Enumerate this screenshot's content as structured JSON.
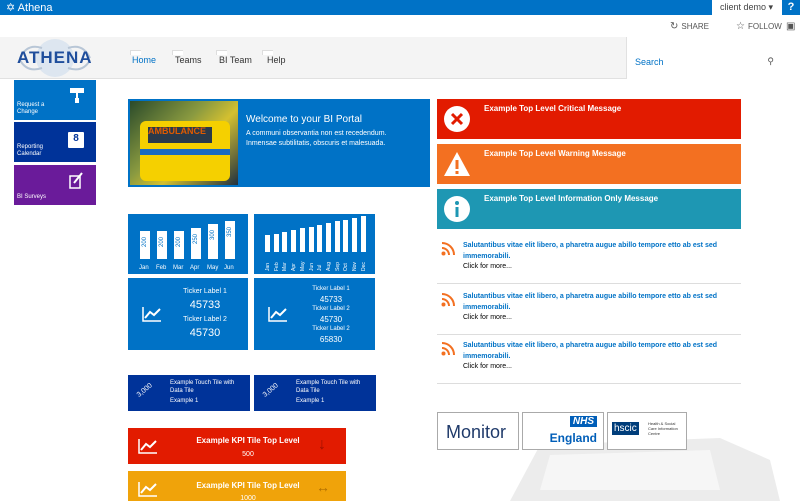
{
  "suite": {
    "brand": "Athena",
    "user": "client demo ▾",
    "help": "?"
  },
  "ribbon": {
    "share": "SHARE",
    "follow": "FOLLOW"
  },
  "logo": {
    "text": "ATHENA"
  },
  "nav": [
    {
      "label": "Home",
      "active": true
    },
    {
      "label": "Teams"
    },
    {
      "label": "BI Team"
    },
    {
      "label": "Help"
    }
  ],
  "search": {
    "placeholder": "Search"
  },
  "left_tiles": [
    {
      "label": "Request a Change",
      "color": "#0072c6"
    },
    {
      "label": "Reporting Calendar",
      "color": "#003399",
      "day": "8"
    },
    {
      "label": "BI Surveys",
      "color": "#6a1b9a"
    }
  ],
  "welcome": {
    "title": "Welcome to your BI Portal",
    "body": "A communi observantia non est recedendum. Inmensae subtilitatis, obscuris et malesuada.",
    "image_text": "AMBULANCE"
  },
  "messages": [
    {
      "text": "Example Top Level Critical Message",
      "color": "#e21b00"
    },
    {
      "text": "Example Top Level Warning Message",
      "color": "#f37021"
    },
    {
      "text": "Example Top Level Information Only Message",
      "color": "#1e97b3"
    }
  ],
  "chart1": {
    "categories": [
      "Jan",
      "Feb",
      "Mar",
      "Apr",
      "May",
      "Jun"
    ],
    "values": [
      200,
      200,
      200,
      250,
      300,
      350
    ]
  },
  "chart2": {
    "categories": [
      "Jan",
      "Feb",
      "Mar",
      "Apr",
      "May",
      "Jun",
      "Jul",
      "Aug",
      "Sep",
      "Oct",
      "Nov",
      "Dec"
    ],
    "values": [
      5,
      6,
      7,
      8,
      9,
      10,
      11,
      12,
      13,
      14,
      15,
      16
    ]
  },
  "ticker1": {
    "label1": "Ticker Label 1",
    "value1": "45733",
    "label2": "Ticker Label 2",
    "value2": "45730"
  },
  "ticker2": {
    "label1": "Ticker Label 1",
    "value1": "45733",
    "label2": "Ticker Label 2",
    "value2": "45730",
    "label3": "Ticker Label 2",
    "value3": "65830"
  },
  "touch": [
    {
      "badge": "3,000",
      "title": "Example Touch Tile with Data Tile",
      "sub": "Example 1"
    },
    {
      "badge": "3,000",
      "title": "Example Touch Tile with Data Tile",
      "sub": "Example 1"
    }
  ],
  "kpi": [
    {
      "title": "Example KPI Tile Top Level",
      "value": "500",
      "color": "#e21b00",
      "arrow": "↓"
    },
    {
      "title": "Example KPI Tile Top Level",
      "value": "1000",
      "color": "#f0a30a",
      "arrow": "↔"
    }
  ],
  "news": [
    {
      "title": "Salutantibus vitae elit libero, a pharetra augue abillo tempore etto ab est sed immemorabili.",
      "cta": "Click for more..."
    },
    {
      "title": "Salutantibus vitae elit libero, a pharetra augue abillo tempore etto ab est sed immemorabili.",
      "cta": "Click for more..."
    },
    {
      "title": "Salutantibus vitae elit libero, a pharetra augue abillo tempore etto ab est sed immemorabili.",
      "cta": "Click for more..."
    }
  ],
  "partners": {
    "monitor": "Monitor",
    "nhs": "NHS",
    "england": "England",
    "hscic": "hscic",
    "hscic_sub": "Health & Social Care Information Centre"
  }
}
